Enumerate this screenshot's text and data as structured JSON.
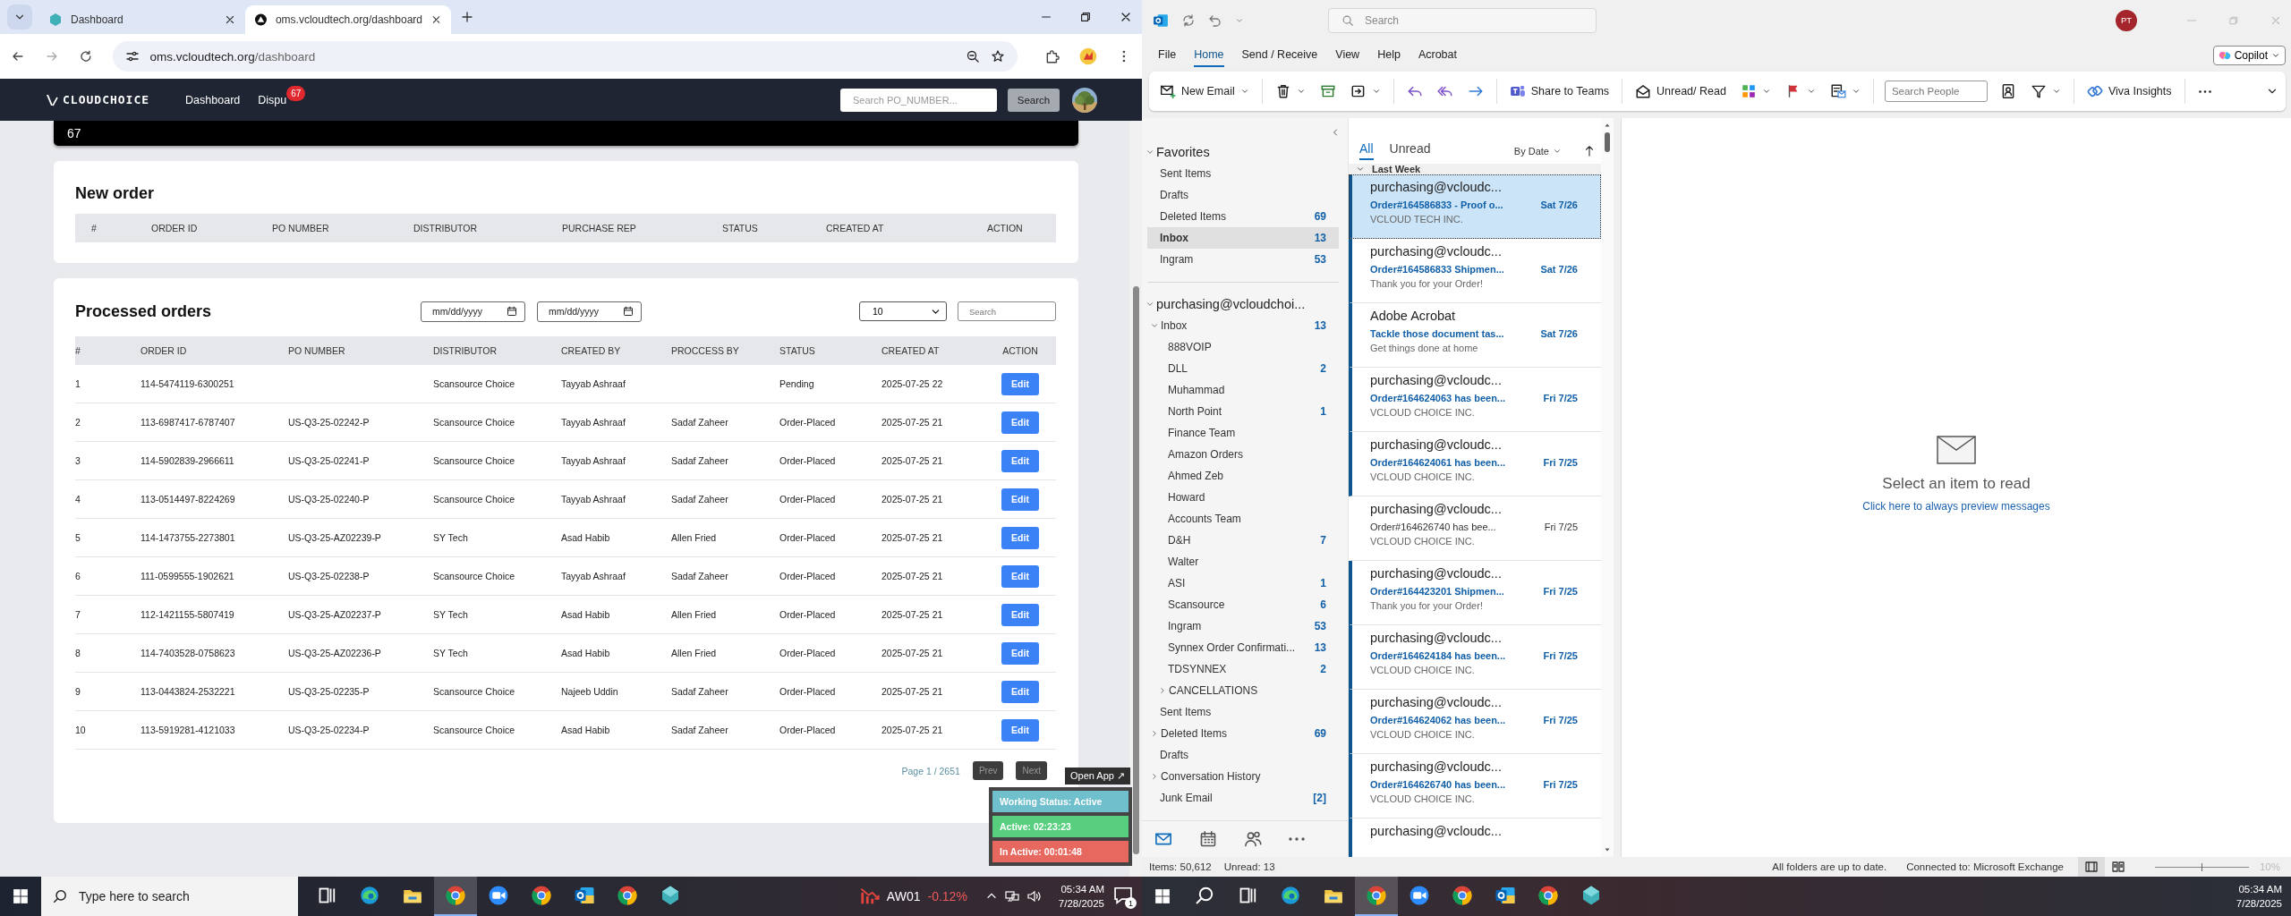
{
  "browser": {
    "tabs": [
      {
        "title": "Dashboard",
        "selected": false
      },
      {
        "title": "oms.vcloudtech.org/dashboard",
        "selected": true
      }
    ],
    "url_host": "oms.vcloudtech.org",
    "url_path": "/dashboard",
    "app": {
      "logo": "CLOUDCHOICE",
      "nav": [
        {
          "label": "Dashboard"
        },
        {
          "label": "Dispu",
          "badge": "67"
        }
      ],
      "search": {
        "placeholder": "Search PO_NUMBER..."
      },
      "search_button": "Search",
      "banner_value": "67",
      "new_order": {
        "title": "New order",
        "columns": [
          "#",
          "ORDER ID",
          "PO NUMBER",
          "DISTRIBUTOR",
          "PURCHASE REP",
          "STATUS",
          "CREATED AT",
          "ACTION"
        ]
      },
      "processed": {
        "title": "Processed orders",
        "date_from": "mm/dd/yyyy",
        "date_to": "mm/dd/yyyy",
        "page_size": "10",
        "search": {
          "placeholder": "Search"
        },
        "columns": [
          "#",
          "ORDER ID",
          "PO NUMBER",
          "DISTRIBUTOR",
          "CREATED BY",
          "PROCCESS BY",
          "STATUS",
          "CREATED AT",
          "ACTION"
        ],
        "rows": [
          {
            "n": "1",
            "order_id": "114-5474119-6300251",
            "distributor": "Scansource Choice",
            "created_by": "Tayyab Ashraaf",
            "status": "Pending",
            "created_at": "2025-07-25 22",
            "action": "Edit"
          },
          {
            "n": "2",
            "order_id": "113-6987417-6787407",
            "po_number": "US-Q3-25-02242-P",
            "distributor": "Scansource Choice",
            "created_by": "Tayyab Ashraaf",
            "processed_by": "Sadaf Zaheer",
            "status": "Order-Placed",
            "created_at": "2025-07-25 21",
            "action": "Edit"
          },
          {
            "n": "3",
            "order_id": "114-5902839-2966611",
            "po_number": "US-Q3-25-02241-P",
            "distributor": "Scansource Choice",
            "created_by": "Tayyab Ashraaf",
            "processed_by": "Sadaf Zaheer",
            "status": "Order-Placed",
            "created_at": "2025-07-25 21",
            "action": "Edit"
          },
          {
            "n": "4",
            "order_id": "113-0514497-8224269",
            "po_number": "US-Q3-25-02240-P",
            "distributor": "Scansource Choice",
            "created_by": "Tayyab Ashraaf",
            "processed_by": "Sadaf Zaheer",
            "status": "Order-Placed",
            "created_at": "2025-07-25 21",
            "action": "Edit"
          },
          {
            "n": "5",
            "order_id": "114-1473755-2273801",
            "po_number": "US-Q3-25-AZ02239-P",
            "distributor": "SY Tech",
            "created_by": "Asad Habib",
            "processed_by": "Allen Fried",
            "status": "Order-Placed",
            "created_at": "2025-07-25 21",
            "action": "Edit"
          },
          {
            "n": "6",
            "order_id": "111-0599555-1902621",
            "po_number": "US-Q3-25-02238-P",
            "distributor": "Scansource Choice",
            "created_by": "Tayyab Ashraaf",
            "processed_by": "Sadaf Zaheer",
            "status": "Order-Placed",
            "created_at": "2025-07-25 21",
            "action": "Edit"
          },
          {
            "n": "7",
            "order_id": "112-1421155-5807419",
            "po_number": "US-Q3-25-AZ02237-P",
            "distributor": "SY Tech",
            "created_by": "Asad Habib",
            "processed_by": "Allen Fried",
            "status": "Order-Placed",
            "created_at": "2025-07-25 21",
            "action": "Edit"
          },
          {
            "n": "8",
            "order_id": "114-7403528-0758623",
            "po_number": "US-Q3-25-AZ02236-P",
            "distributor": "SY Tech",
            "created_by": "Asad Habib",
            "processed_by": "Allen Fried",
            "status": "Order-Placed",
            "created_at": "2025-07-25 21",
            "action": "Edit"
          },
          {
            "n": "9",
            "order_id": "113-0443824-2532221",
            "po_number": "US-Q3-25-02235-P",
            "distributor": "Scansource Choice",
            "created_by": "Najeeb Uddin",
            "processed_by": "Sadaf Zaheer",
            "status": "Order-Placed",
            "created_at": "2025-07-25 21",
            "action": "Edit"
          },
          {
            "n": "10",
            "order_id": "113-5919281-4121033",
            "po_number": "US-Q3-25-02234-P",
            "distributor": "Scansource Choice",
            "created_by": "Asad Habib",
            "processed_by": "Sadaf Zaheer",
            "status": "Order-Placed",
            "created_at": "2025-07-25 21",
            "action": "Edit"
          }
        ],
        "page": "Page 1 / 2651",
        "prev": "Prev",
        "next": "Next"
      },
      "tracker": {
        "open_app": "Open App ↗",
        "rows": [
          {
            "text": "Working Status: Active",
            "kind": "status"
          },
          {
            "text": "Active: 02:23:23",
            "kind": "active"
          },
          {
            "text": "In Active: 00:01:48",
            "kind": "inactive"
          }
        ]
      }
    }
  },
  "outlook": {
    "search": {
      "placeholder": "Search"
    },
    "avatar": "PT",
    "menu": [
      {
        "label": "File",
        "selected": false
      },
      {
        "label": "Home",
        "selected": true
      },
      {
        "label": "Send / Receive",
        "selected": false
      },
      {
        "label": "View",
        "selected": false
      },
      {
        "label": "Help",
        "selected": false
      },
      {
        "label": "Acrobat",
        "selected": false
      }
    ],
    "copilot": "Copilot",
    "ribbon": {
      "new_email": "New Email",
      "share": "Share to Teams",
      "unread_read": "Unread/ Read",
      "search_people": {
        "placeholder": "Search People"
      },
      "viva": "Viva Insights"
    },
    "folders": [
      {
        "label": "Favorites",
        "expanded": true,
        "children": [
          {
            "label": "Sent Items",
            "selected": false
          },
          {
            "label": "Drafts",
            "selected": false
          },
          {
            "label": "Deleted Items",
            "count": "69",
            "selected": false
          },
          {
            "label": "Inbox",
            "count": "13",
            "selected": true
          },
          {
            "label": "Ingram",
            "count": "53",
            "selected": false
          }
        ]
      },
      {
        "label": "purchasing@vcloudchoi...",
        "expanded": true,
        "children": [
          {
            "label": "Inbox",
            "count": "13",
            "selected": false,
            "expanded": true,
            "children": [
              {
                "label": "888VOIP",
                "selected": false
              },
              {
                "label": "DLL",
                "count": "2",
                "selected": false
              },
              {
                "label": "Muhammad",
                "selected": false
              },
              {
                "label": "North Point",
                "count": "1",
                "selected": false
              },
              {
                "label": "Finance Team",
                "selected": false
              },
              {
                "label": "Amazon Orders",
                "selected": false
              },
              {
                "label": "Ahmed Zeb",
                "selected": false
              },
              {
                "label": "Howard",
                "selected": false
              },
              {
                "label": "Accounts Team",
                "selected": false
              },
              {
                "label": "D&H",
                "count": "7",
                "selected": false
              },
              {
                "label": "Walter",
                "selected": false
              },
              {
                "label": "ASI",
                "count": "1",
                "selected": false
              },
              {
                "label": "Scansource",
                "count": "6",
                "selected": false
              },
              {
                "label": "Ingram",
                "count": "53",
                "selected": false
              },
              {
                "label": "Synnex Order Confirmati...",
                "count": "13",
                "selected": false
              },
              {
                "label": "TDSYNNEX",
                "count": "2",
                "selected": false
              },
              {
                "label": "CANCELLATIONS",
                "selected": false,
                "expanded": false
              }
            ]
          },
          {
            "label": "Sent Items",
            "selected": false
          },
          {
            "label": "Deleted Items",
            "count": "69",
            "selected": false,
            "expanded": false
          },
          {
            "label": "Drafts",
            "selected": false
          },
          {
            "label": "Conversation History",
            "selected": false,
            "expanded": false
          },
          {
            "label": "Junk Email",
            "count": "[2]",
            "selected": false
          }
        ]
      }
    ],
    "list_tabs": [
      {
        "label": "All",
        "selected": true
      },
      {
        "label": "Unread",
        "selected": false
      }
    ],
    "sort": "By Date",
    "group": "Last Week",
    "messages": [
      {
        "sender": "purchasing@vcloudc...",
        "subject": "Order#164586833 - Proof o...",
        "preview": "VCLOUD TECH INC.",
        "date": "Sat 7/26",
        "unread": true,
        "selected": true
      },
      {
        "sender": "purchasing@vcloudc...",
        "subject": "Order#164586833 Shipmen...",
        "preview": "Thank you for your Order!",
        "date": "Sat 7/26",
        "unread": true,
        "selected": false
      },
      {
        "sender": "Adobe Acrobat",
        "subject": "Tackle those document tas...",
        "preview": "Get things done at home",
        "date": "Sat 7/26",
        "unread": true,
        "selected": false
      },
      {
        "sender": "purchasing@vcloudc...",
        "subject": "Order#164624063 has been...",
        "preview": "VCLOUD CHOICE INC.",
        "date": "Fri 7/25",
        "unread": true,
        "selected": false
      },
      {
        "sender": "purchasing@vcloudc...",
        "subject": "Order#164624061 has been...",
        "preview": "VCLOUD CHOICE INC.",
        "date": "Fri 7/25",
        "unread": true,
        "selected": false
      },
      {
        "sender": "purchasing@vcloudc...",
        "subject": "Order#164626740 has bee...",
        "preview": "VCLOUD CHOICE INC.",
        "date": "Fri 7/25",
        "unread": false,
        "selected": false
      },
      {
        "sender": "purchasing@vcloudc...",
        "subject": "Order#164423201 Shipmen...",
        "preview": "Thank you for your Order!",
        "date": "Fri 7/25",
        "unread": true,
        "selected": false
      },
      {
        "sender": "purchasing@vcloudc...",
        "subject": "Order#164624184 has been...",
        "preview": "VCLOUD CHOICE INC.",
        "date": "Fri 7/25",
        "unread": true,
        "selected": false
      },
      {
        "sender": "purchasing@vcloudc...",
        "subject": "Order#164624062 has been...",
        "preview": "VCLOUD CHOICE INC.",
        "date": "Fri 7/25",
        "unread": true,
        "selected": false
      },
      {
        "sender": "purchasing@vcloudc...",
        "subject": "Order#164626740 has been...",
        "preview": "VCLOUD CHOICE INC.",
        "date": "Fri 7/25",
        "unread": true,
        "selected": false
      },
      {
        "sender": "purchasing@vcloudc...",
        "unread": true,
        "selected": false
      }
    ],
    "reading": {
      "title": "Select an item to read",
      "link": "Click here to always preview messages"
    },
    "status": {
      "items": "Items: 50,612",
      "unread": "Unread: 13",
      "sync": "All folders are up to date.",
      "connection": "Connected to: Microsoft Exchange",
      "zoom": "10%",
      "zoom_level": {
        "level": 0.5
      }
    }
  },
  "taskbar_left": {
    "search_placeholder": "Type here to search",
    "apps": [
      {
        "kind": "taskview",
        "selected": false
      },
      {
        "kind": "edge",
        "selected": false
      },
      {
        "kind": "explorer",
        "selected": false
      },
      {
        "kind": "chrome",
        "selected": true
      },
      {
        "kind": "zoom",
        "selected": false
      },
      {
        "kind": "chrome",
        "selected": false
      },
      {
        "kind": "outlook",
        "selected": false
      },
      {
        "kind": "chrome",
        "selected": false
      },
      {
        "kind": "app",
        "selected": false
      }
    ],
    "ticker": "AW01",
    "change": "-0.12%",
    "time": "05:34 AM",
    "date": "7/28/2025",
    "notifications": "1"
  },
  "taskbar_right": {
    "apps": [
      {
        "kind": "search",
        "selected": false
      },
      {
        "kind": "taskview",
        "selected": false
      },
      {
        "kind": "edge",
        "selected": false
      },
      {
        "kind": "explorer",
        "selected": false
      },
      {
        "kind": "chrome",
        "selected": true
      },
      {
        "kind": "zoom",
        "selected": false
      },
      {
        "kind": "chrome",
        "selected": false
      },
      {
        "kind": "outlook",
        "selected": false
      },
      {
        "kind": "chrome",
        "selected": false
      },
      {
        "kind": "app",
        "selected": false
      }
    ],
    "time": "05:34 AM",
    "date": "7/28/2025"
  }
}
